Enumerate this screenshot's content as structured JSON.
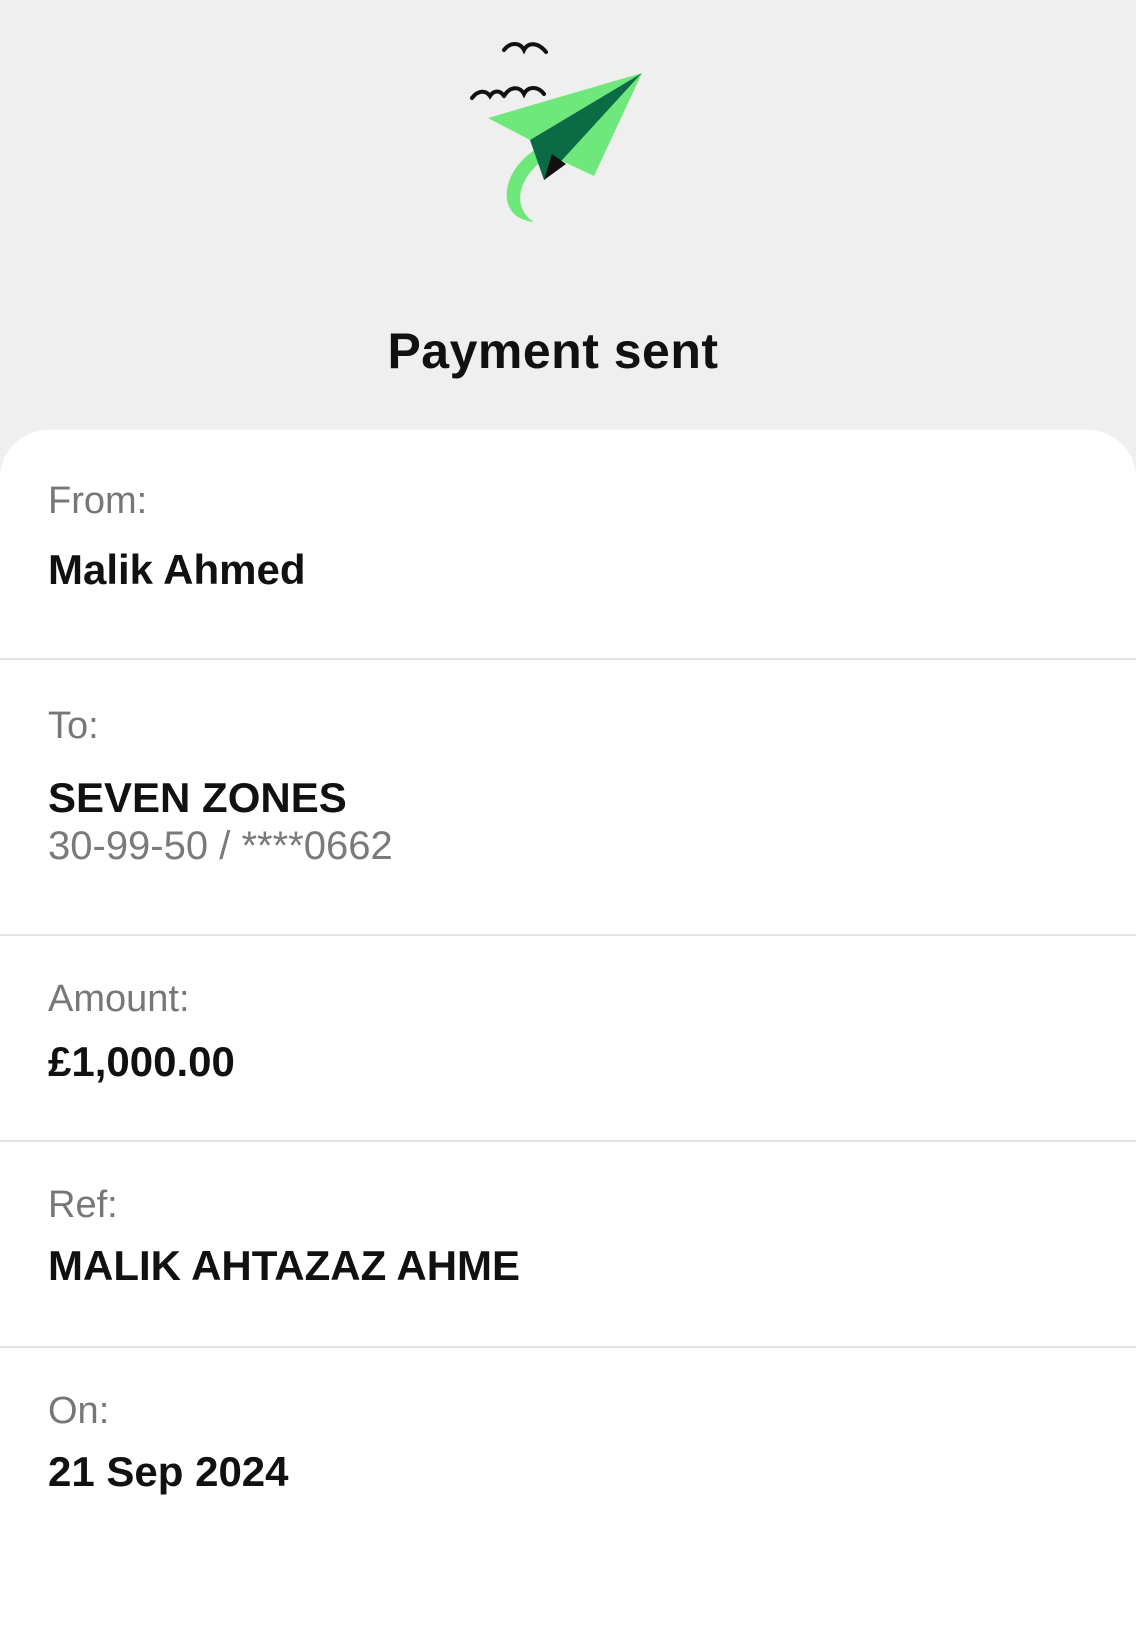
{
  "header": {
    "title": "Payment sent",
    "illustration_icon": "paper-plane-icon",
    "colors": {
      "plane_light": "#6ee87a",
      "plane_dark": "#0b6b45",
      "birds": "#111111"
    }
  },
  "details": {
    "from": {
      "label": "From:",
      "value": "Malik Ahmed"
    },
    "to": {
      "label": "To:",
      "value": "SEVEN ZONES",
      "account": "30-99-50 / ****0662"
    },
    "amount": {
      "label": "Amount:",
      "value": "£1,000.00"
    },
    "ref": {
      "label": "Ref:",
      "value": "MALIK AHTAZAZ AHME"
    },
    "on": {
      "label": "On:",
      "value": "21 Sep 2024"
    }
  }
}
